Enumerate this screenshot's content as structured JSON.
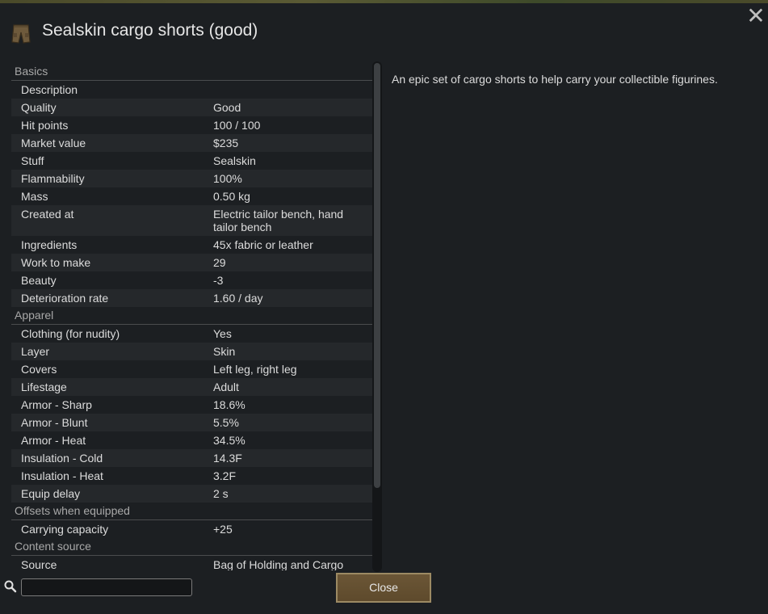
{
  "title": "Sealskin cargo shorts (good)",
  "close_x": "✕",
  "icon": "cargo-shorts-icon",
  "description": "An epic set of cargo shorts to help carry your collectible figurines.",
  "sections": [
    {
      "heading": "Basics",
      "rows": [
        {
          "label": "Description",
          "value": ""
        },
        {
          "label": "Quality",
          "value": "Good"
        },
        {
          "label": "Hit points",
          "value": "100 / 100"
        },
        {
          "label": "Market value",
          "value": "$235"
        },
        {
          "label": "Stuff",
          "value": "Sealskin"
        },
        {
          "label": "Flammability",
          "value": "100%"
        },
        {
          "label": "Mass",
          "value": "0.50 kg"
        },
        {
          "label": "Created at",
          "value": "Electric tailor bench, hand tailor bench"
        },
        {
          "label": "Ingredients",
          "value": "45x fabric or leather"
        },
        {
          "label": "Work to make",
          "value": "29"
        },
        {
          "label": "Beauty",
          "value": "-3"
        },
        {
          "label": "Deterioration rate",
          "value": "1.60 / day"
        }
      ]
    },
    {
      "heading": "Apparel",
      "rows": [
        {
          "label": "Clothing (for nudity)",
          "value": "Yes"
        },
        {
          "label": "Layer",
          "value": "Skin"
        },
        {
          "label": "Covers",
          "value": "Left leg, right leg"
        },
        {
          "label": "Lifestage",
          "value": "Adult"
        },
        {
          "label": "Armor - Sharp",
          "value": "18.6%"
        },
        {
          "label": "Armor - Blunt",
          "value": "5.5%"
        },
        {
          "label": "Armor - Heat",
          "value": "34.5%"
        },
        {
          "label": "Insulation - Cold",
          "value": "14.3F"
        },
        {
          "label": "Insulation - Heat",
          "value": "3.2F"
        },
        {
          "label": "Equip delay",
          "value": "2 s"
        }
      ]
    },
    {
      "heading": "Offsets when equipped",
      "rows": [
        {
          "label": "Carrying capacity",
          "value": "+25"
        }
      ]
    },
    {
      "heading": "Content source",
      "rows": [
        {
          "label": "Source",
          "value": "Bag of Holding and Cargo"
        }
      ]
    }
  ],
  "search": {
    "icon": "search-icon",
    "value": "",
    "placeholder": ""
  },
  "close_button": "Close"
}
